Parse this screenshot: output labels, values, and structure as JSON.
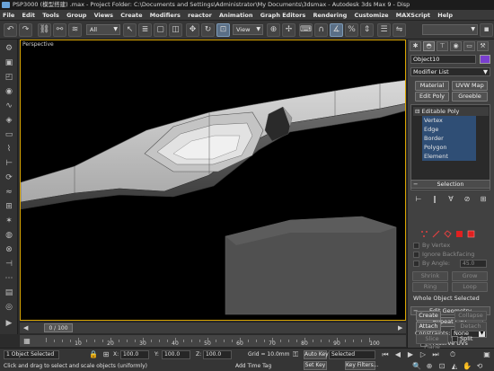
{
  "window": {
    "title": "PSP3000 (模型搭建) .max - Project Folder: C:\\Documents and Settings\\Administrator\\My Documents\\3dsmax - Autodesk 3ds Max 9 - Disp"
  },
  "menu": [
    "File",
    "Edit",
    "Tools",
    "Group",
    "Views",
    "Create",
    "Modifiers",
    "reactor",
    "Animation",
    "Graph Editors",
    "Rendering",
    "Customize",
    "MAXScript",
    "Help"
  ],
  "toolbar": {
    "selection_filter": "All",
    "coord_system": "View"
  },
  "viewport": {
    "label": "Perspective"
  },
  "command_panel": {
    "object_name": "Object10",
    "object_color": "#7a3fd0",
    "modifier_list": "Modifier List",
    "buttons": [
      "Material",
      "UVW Map",
      "Edit Poly",
      "Greeble"
    ],
    "stack": {
      "root": "Editable Poly",
      "subs": [
        "Vertex",
        "Edge",
        "Border",
        "Polygon",
        "Element"
      ]
    },
    "selection": {
      "title": "Selection",
      "by_vertex": "By Vertex",
      "ignore_backfacing": "Ignore Backfacing",
      "by_angle": "By Angle:",
      "angle_value": "45.0",
      "shrink": "Shrink",
      "grow": "Grow",
      "ring": "Ring",
      "loop": "Loop",
      "status": "Whole Object Selected"
    },
    "edit_geometry": {
      "title": "Edit Geometry",
      "repeat_last": "Repeat Last",
      "constraints_label": "Constraints:",
      "constraints_value": "None",
      "preserve_uvs": "Preserve UVs",
      "create": "Create",
      "collapse": "Collapse",
      "attach": "Attach",
      "detach": "Detach",
      "slice_plane": "Slice Plane",
      "split": "Split"
    }
  },
  "timeline": {
    "frame": "0 / 100",
    "ticks": [
      "10",
      "20",
      "30",
      "40",
      "50",
      "60",
      "70",
      "80",
      "90",
      "100"
    ]
  },
  "status": {
    "selection": "1 Object Selected",
    "prompt": "Click and drag to select and scale objects (uniformly)",
    "x": "100.0",
    "y": "100.0",
    "z": "100.0",
    "grid": "Grid = 10.0mm",
    "add_time_tag": "Add Time Tag",
    "auto_key": "Auto Key",
    "set_key": "Set Key",
    "key_mode": "Selected",
    "key_filters": "Key Filters..."
  }
}
